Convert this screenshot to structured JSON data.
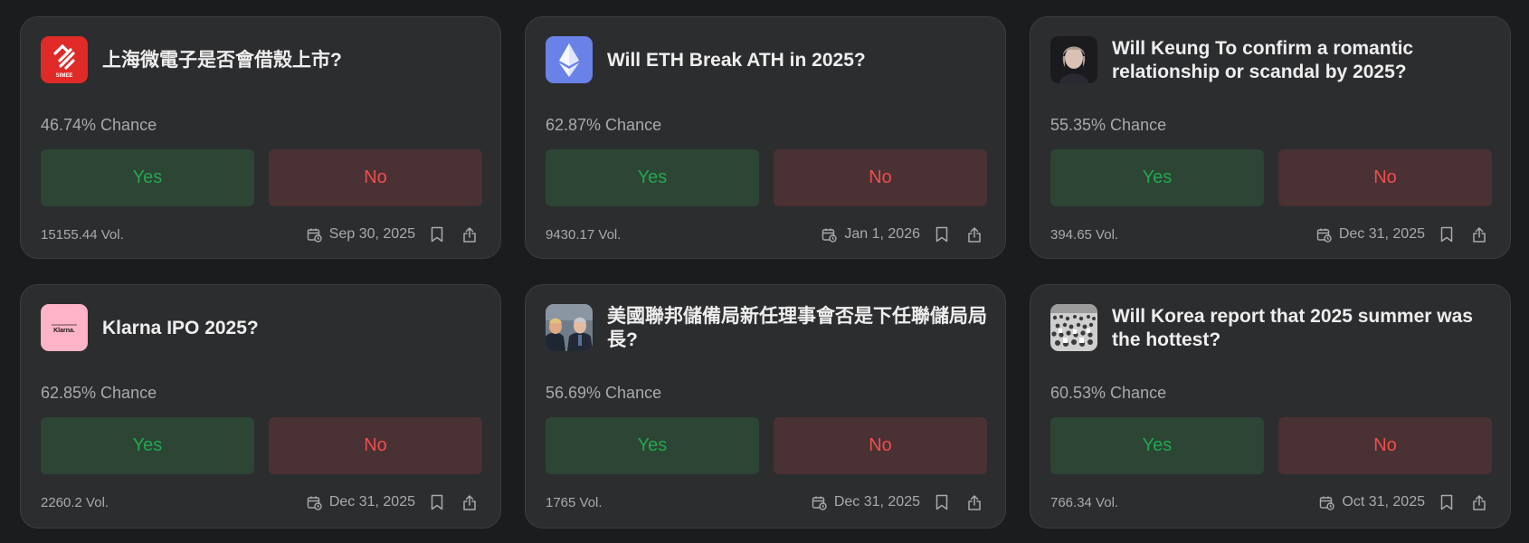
{
  "markets": [
    {
      "thumb": "simee-logo",
      "thumb_text": "SIMEE",
      "title": "上海微電子是否會借殼上市?",
      "chance": "46.74% Chance",
      "yes": "Yes",
      "no": "No",
      "volume": "15155.44 Vol.",
      "date": "Sep 30, 2025"
    },
    {
      "thumb": "ethereum-logo",
      "title": "Will ETH Break ATH in 2025?",
      "chance": "62.87% Chance",
      "yes": "Yes",
      "no": "No",
      "volume": "9430.17 Vol.",
      "date": "Jan 1, 2026"
    },
    {
      "thumb": "person-photo",
      "title": "Will Keung To confirm a romantic relationship or scandal by 2025?",
      "chance": "55.35% Chance",
      "yes": "Yes",
      "no": "No",
      "volume": "394.65 Vol.",
      "date": "Dec 31, 2025"
    },
    {
      "thumb": "klarna-logo",
      "thumb_text": "Klarna.",
      "title": "Klarna IPO 2025?",
      "chance": "62.85% Chance",
      "yes": "Yes",
      "no": "No",
      "volume": "2260.2 Vol.",
      "date": "Dec 31, 2025"
    },
    {
      "thumb": "officials-photo",
      "title": "美國聯邦儲備局新任理事會否是下任聯儲局局長?",
      "chance": "56.69% Chance",
      "yes": "Yes",
      "no": "No",
      "volume": "1765 Vol.",
      "date": "Dec 31, 2025"
    },
    {
      "thumb": "crowd-photo",
      "title": "Will Korea report that 2025 summer was the hottest?",
      "chance": "60.53% Chance",
      "yes": "Yes",
      "no": "No",
      "volume": "766.34 Vol.",
      "date": "Oct 31, 2025"
    }
  ],
  "colors": {
    "background": "#1b1c1e",
    "card": "#2c2d2f",
    "yes_bg": "#2c4535",
    "yes_text": "#23a64f",
    "no_bg": "#4a3133",
    "no_text": "#ef4d4d",
    "muted_text": "#a9aaad",
    "title_text": "#eeeeee"
  },
  "icons": {
    "date": "calendar-clock-icon",
    "bookmark": "bookmark-icon",
    "share": "share-icon"
  }
}
